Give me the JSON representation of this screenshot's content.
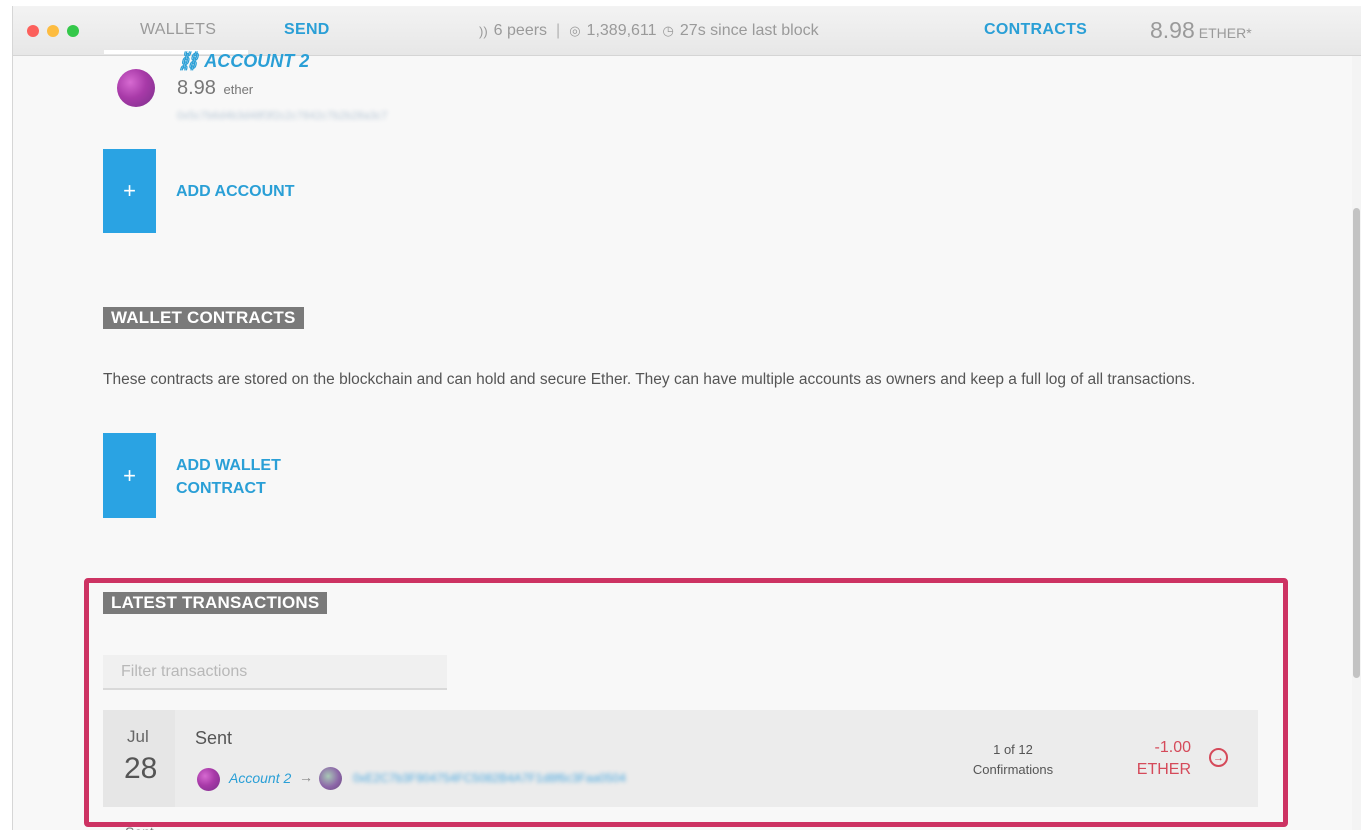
{
  "nav": {
    "wallets_label": "WALLETS",
    "send_label": "SEND",
    "contracts_label": "CONTRACTS"
  },
  "status": {
    "peers": "6 peers",
    "block": "1,389,611",
    "since_block": "27s since last block"
  },
  "balance": {
    "amount": "8.98",
    "unit": "ETHER*"
  },
  "account": {
    "name": "ACCOUNT 2",
    "balance": "8.98",
    "unit": "ether",
    "address": "0x5c7b6d4b3d48f3f2c2c7842c7b2b28a3c7"
  },
  "add_account_label": "ADD ACCOUNT",
  "wallet_contracts": {
    "title": "WALLET CONTRACTS",
    "description": "These contracts are stored on the blockchain and can hold and secure Ether. They can have multiple accounts as owners and keep a full log of all transactions.",
    "add_label": "ADD WALLET CONTRACT"
  },
  "transactions": {
    "title": "LATEST TRANSACTIONS",
    "filter_placeholder": "Filter transactions",
    "items": [
      {
        "month": "Jul",
        "day": "28",
        "type": "Sent",
        "from": "Account 2",
        "to": "0xE2C7b3F904754FC5082B4A7F1d8f6c3Faa0504",
        "confirmations_count": "1 of 12",
        "confirmations_label": "Confirmations",
        "amount": "-1.00",
        "unit": "ETHER"
      }
    ],
    "next_type": "Sent"
  },
  "colors": {
    "accent": "#2a9fd6",
    "add_button": "#2aa3e3",
    "negative": "#d54a5a",
    "highlight": "#cd3363",
    "section_badge": "#7a7a7a"
  },
  "icons": [
    "peers-icon",
    "block-icon",
    "clock-icon",
    "link-icon",
    "plus-icon",
    "arrow-right-circle-icon"
  ]
}
